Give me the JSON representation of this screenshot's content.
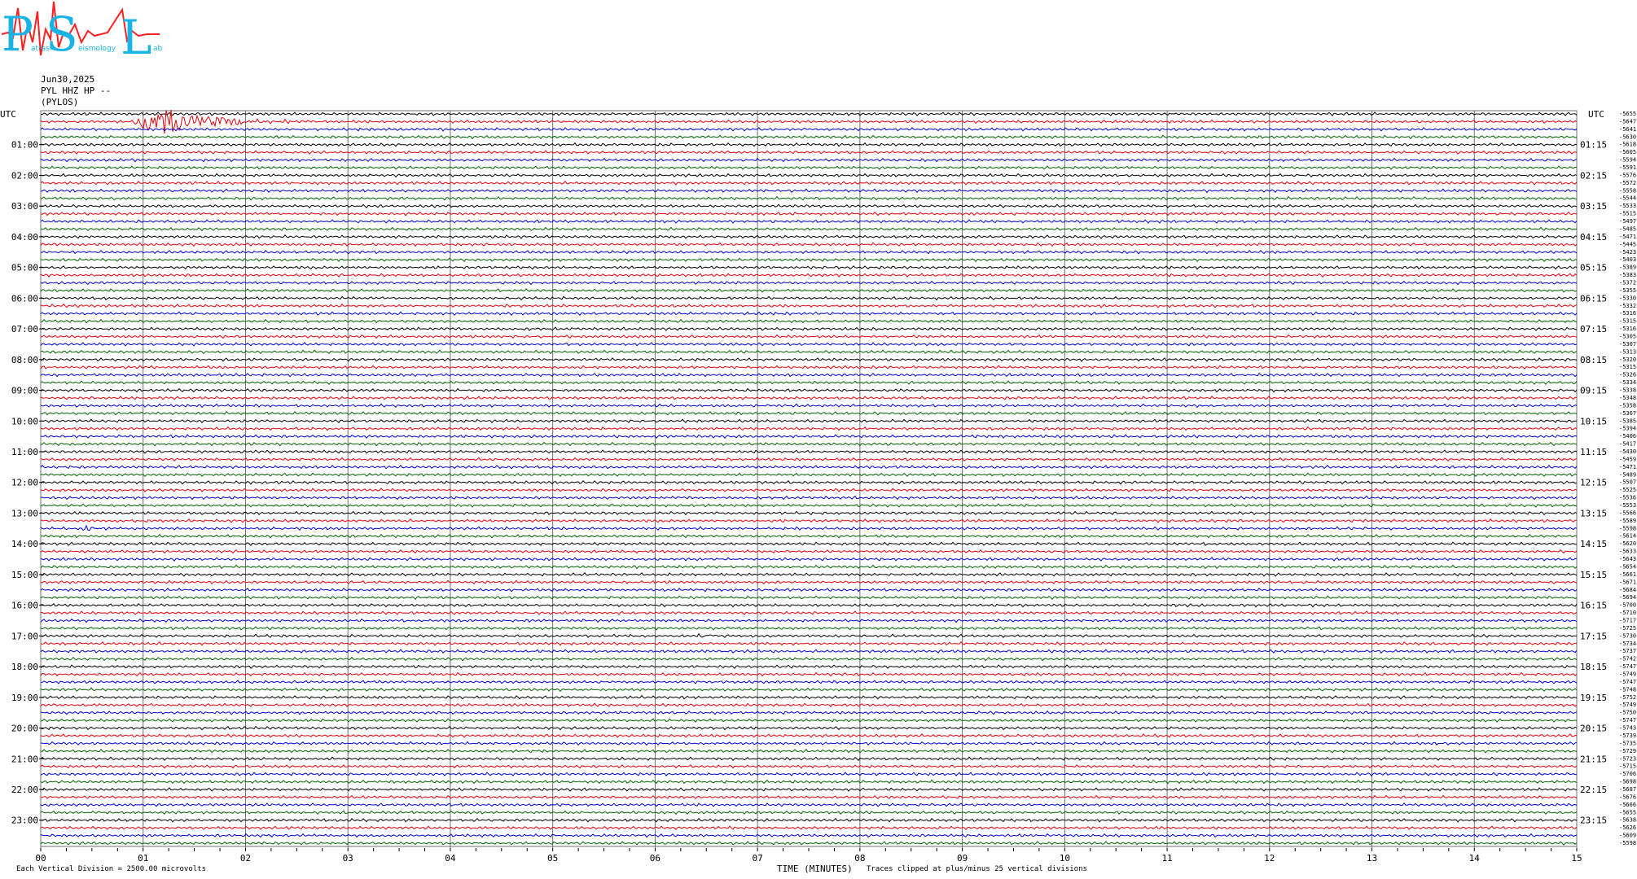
{
  "header": {
    "date": "Jun30,2025",
    "station": "PYL HHZ HP --",
    "place": "(PYLOS)"
  },
  "logo": {
    "letters": [
      "P",
      "S",
      "L"
    ],
    "small_words": [
      "atras",
      "eismology",
      "ab"
    ],
    "colors": {
      "letters": "#19b4e6",
      "wave": "#ff2020"
    }
  },
  "colors": {
    "trace_cycle": [
      "#000000",
      "#e8000b",
      "#0000d8",
      "#006400"
    ],
    "grid": "#707070"
  },
  "chart_data": {
    "type": "line",
    "subtype": "helicorder",
    "left_title": "UTC",
    "right_title": "UTC",
    "left_hour_labels": [
      "01:00",
      "02:00",
      "03:00",
      "04:00",
      "05:00",
      "06:00",
      "07:00",
      "08:00",
      "09:00",
      "10:00",
      "11:00",
      "12:00",
      "13:00",
      "14:00",
      "15:00",
      "16:00",
      "17:00",
      "18:00",
      "19:00",
      "20:00",
      "21:00",
      "22:00",
      "23:00"
    ],
    "right_hour_labels": [
      "01:15",
      "02:15",
      "03:15",
      "04:15",
      "05:15",
      "06:15",
      "07:15",
      "08:15",
      "09:15",
      "10:15",
      "11:15",
      "12:15",
      "13:15",
      "14:15",
      "15:15",
      "16:15",
      "17:15",
      "18:15",
      "19:15",
      "20:15",
      "21:15",
      "22:15",
      "23:15"
    ],
    "x_ticks": [
      "00",
      "01",
      "02",
      "03",
      "04",
      "05",
      "06",
      "07",
      "08",
      "09",
      "10",
      "11",
      "12",
      "13",
      "14",
      "15"
    ],
    "xlabel": "TIME (MINUTES)",
    "xlim": [
      0,
      15
    ],
    "traces_per_hour": 4,
    "num_traces": 96,
    "offsets": [
      -5655,
      -5647,
      -5641,
      -5630,
      -5618,
      -5605,
      -5594,
      -5591,
      -5576,
      -5572,
      -5558,
      -5544,
      -5533,
      -5515,
      -5497,
      -5485,
      -5471,
      -5445,
      -5423,
      -5403,
      -5389,
      -5383,
      -5372,
      -5355,
      -5330,
      -5332,
      -5316,
      -5315,
      -5316,
      -5305,
      -5307,
      -5313,
      -5320,
      -5315,
      -5326,
      -5334,
      -5338,
      -5348,
      -5358,
      -5367,
      -5385,
      -5394,
      -5406,
      -5417,
      -5430,
      -5459,
      -5471,
      -5489,
      -5507,
      -5525,
      -5536,
      -5553,
      -5566,
      -5589,
      -5598,
      -5614,
      -5620,
      -5633,
      -5643,
      -5654,
      -5661,
      -5671,
      -5684,
      -5694,
      -5700,
      -5710,
      -5717,
      -5725,
      -5730,
      -5734,
      -5737,
      -5742,
      -5747,
      -5749,
      -5747,
      -5748,
      -5752,
      -5749,
      -5750,
      -5747,
      -5743,
      -5739,
      -5735,
      -5729,
      -5723,
      -5715,
      -5706,
      -5698,
      -5687,
      -5676,
      -5666,
      -5655,
      -5638,
      -5626,
      -5609,
      -5598
    ],
    "events": [
      {
        "trace": 1,
        "start_min": 0.9,
        "end_min": 2.7,
        "peak_divisions": 4.5
      },
      {
        "trace": 54,
        "start_min": 0.4,
        "end_min": 0.7,
        "peak_divisions": 0.8
      },
      {
        "trace": 68,
        "start_min": 6.4,
        "end_min": 6.9,
        "peak_divisions": 0.5
      }
    ],
    "footer_left": "Each Vertical Division = 2500.00 microvolts",
    "footer_right": "Traces clipped at plus/minus 25 vertical divisions",
    "grid": true
  }
}
